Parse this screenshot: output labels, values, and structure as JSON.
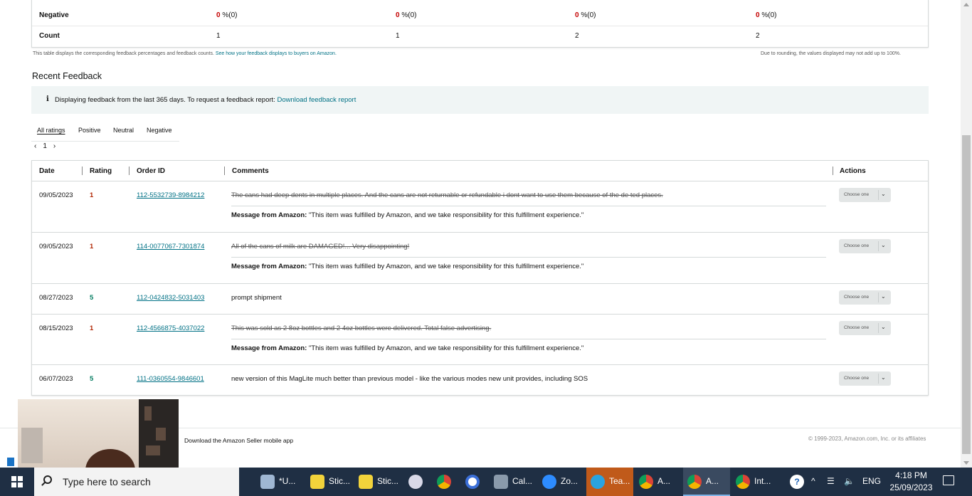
{
  "summary": {
    "rows": [
      {
        "label": "Negative",
        "values": [
          "0",
          "0",
          "0",
          "0"
        ],
        "suffixes": [
          " %(0)",
          " %(0)",
          " %(0)",
          " %(0)"
        ]
      },
      {
        "label": "Count",
        "values": [
          "1",
          "1",
          "2",
          "2"
        ]
      }
    ],
    "note_left": "This table displays the corresponding feedback percentages and feedback counts. ",
    "note_left_link": "See how your feedback displays to buyers on Amazon.",
    "note_right": "Due to rounding, the values displayed may not add up to 100%."
  },
  "recent": {
    "title": "Recent Feedback",
    "info_text": "Displaying feedback from the last 365 days. To request a feedback report: ",
    "info_link": "Download feedback report",
    "tabs": [
      "All ratings",
      "Positive",
      "Neutral",
      "Negative"
    ],
    "pager": {
      "prev": "‹",
      "page": "1",
      "next": "›"
    },
    "columns": [
      "Date",
      "Rating",
      "Order ID",
      "Comments",
      "Actions"
    ],
    "rows": [
      {
        "date": "09/05/2023",
        "rating": "1",
        "order_id": "112-5532739-8984212",
        "comment": "The cans had deep dents in multiple places. And the cans are not returnable or refundable i dont want to use them because of the de ted places.",
        "struck": true,
        "message_label": "Message from Amazon:",
        "message": " \"This item was fulfilled by Amazon, and we take responsibility for this fulfillment experience.\"",
        "action": "Choose one"
      },
      {
        "date": "09/05/2023",
        "rating": "1",
        "order_id": "114-0077067-7301874",
        "comment": "All of the cans of milk are DAMAGED!... Very disappointing!",
        "struck": true,
        "message_label": "Message from Amazon:",
        "message": " \"This item was fulfilled by Amazon, and we take responsibility for this fulfillment experience.\"",
        "action": "Choose one"
      },
      {
        "date": "08/27/2023",
        "rating": "5",
        "order_id": "112-0424832-5031403",
        "comment": "prompt shipment",
        "struck": false,
        "action": "Choose one"
      },
      {
        "date": "08/15/2023",
        "rating": "1",
        "order_id": "112-4566875-4037022",
        "comment": "This was sold as 2 8oz bottles and 2 4oz bottles were delivered. Total false advertising.",
        "struck": true,
        "message_label": "Message from Amazon:",
        "message": " \"This item was fulfilled by Amazon, and we take responsibility for this fulfillment experience.\"",
        "action": "Choose one"
      },
      {
        "date": "06/07/2023",
        "rating": "5",
        "order_id": "111-0360554-9846601",
        "comment": "new version of this MagLite much better than previous model - like the various modes new unit provides, including SOS",
        "struck": false,
        "action": "Choose one"
      }
    ]
  },
  "footer": {
    "left": "Download the Amazon Seller mobile app",
    "right": "© 1999-2023, Amazon.com, Inc. or its affiliates"
  },
  "colors": {
    "link": "#007185",
    "negative": "#b12704",
    "positive": "#067d62",
    "taskbar": "#1f2f44"
  },
  "taskbar": {
    "search_placeholder": "Type here to search",
    "items": [
      {
        "icon": "notepad-icon",
        "label": "*U..."
      },
      {
        "icon": "sticky-notes-icon",
        "label": "Stic..."
      },
      {
        "icon": "sticky-notes-icon",
        "label": "Stic..."
      },
      {
        "icon": "paint-icon",
        "label": ""
      },
      {
        "icon": "chrome-icon",
        "label": ""
      },
      {
        "icon": "cortana-icon",
        "label": ""
      },
      {
        "icon": "calculator-icon",
        "label": "Cal..."
      },
      {
        "icon": "zoom-icon",
        "label": "Zo..."
      },
      {
        "icon": "telegram-icon",
        "label": "Tea..."
      },
      {
        "icon": "chrome-icon",
        "label": "A..."
      },
      {
        "icon": "chrome-icon",
        "label": "A..."
      },
      {
        "icon": "chrome-icon",
        "label": "Int..."
      }
    ],
    "language": "ENG",
    "time": "4:18 PM",
    "date": "25/09/2023"
  }
}
